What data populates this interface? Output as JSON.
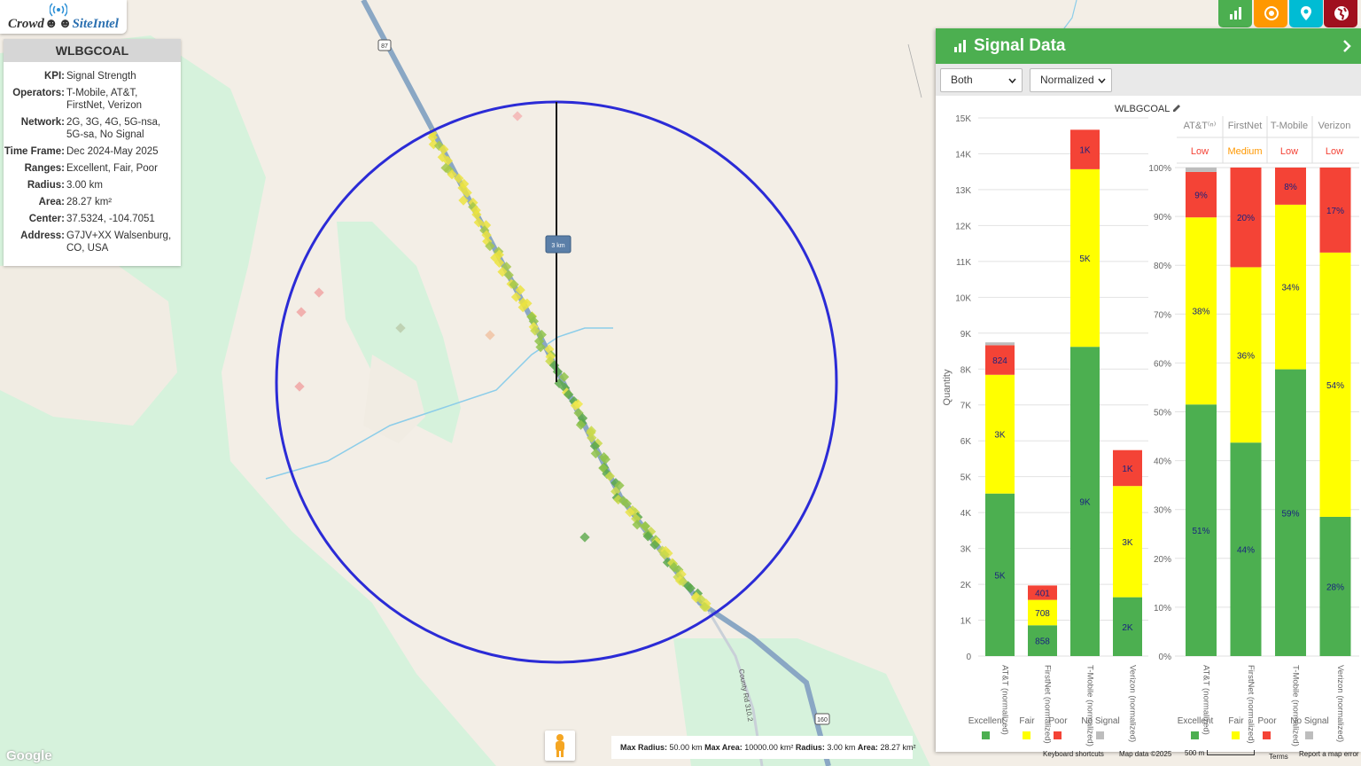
{
  "app": {
    "logo_crowd": "Crowd",
    "logo_site_intel": "SiteIntel"
  },
  "info_panel": {
    "title": "WLBGCOAL",
    "rows": [
      {
        "k": "KPI:",
        "v": "Signal Strength"
      },
      {
        "k": "Operators:",
        "v": "T-Mobile, AT&T, FirstNet, Verizon"
      },
      {
        "k": "Network:",
        "v": "2G, 3G, 4G, 5G-nsa, 5G-sa, No Signal"
      },
      {
        "k": "Time Frame:",
        "v": "Dec 2024-May 2025"
      },
      {
        "k": "Ranges:",
        "v": "Excellent, Fair, Poor"
      },
      {
        "k": "Radius:",
        "v": "3.00 km"
      },
      {
        "k": "Area:",
        "v": "28.27 km²"
      },
      {
        "k": "Center:",
        "v": "37.5324, -104.7051"
      },
      {
        "k": "Address:",
        "v": "G7JV+XX Walsenburg, CO, USA"
      }
    ]
  },
  "top_buttons": [
    {
      "name": "chart-button",
      "color": "#4caf50",
      "icon": "bar-chart-icon"
    },
    {
      "name": "target-button",
      "color": "#ff9800",
      "icon": "target-icon"
    },
    {
      "name": "location-button",
      "color": "#00bcd4",
      "icon": "map-pin-icon"
    },
    {
      "name": "globe-button",
      "color": "#a0101e",
      "icon": "globe-icon"
    }
  ],
  "map": {
    "radius_label": "3 km",
    "route_labels": {
      "r87": "87",
      "r160": "160",
      "county_rd": "County Rd 310.2"
    },
    "footer": {
      "max_radius_label": "Max Radius:",
      "max_radius": "50.00 km",
      "max_area_label": "Max Area:",
      "max_area": "10000.00 km²",
      "radius_label": "Radius:",
      "radius": "3.00 km",
      "area_label": "Area:",
      "area": "28.27 km²"
    },
    "google": "Google",
    "keyboard": "Keyboard shortcuts",
    "map_data": "Map data ©2025",
    "scale": "500 m",
    "terms": "Terms",
    "report": "Report a map error"
  },
  "signal_panel": {
    "title": "Signal Data",
    "select_mode": "Both",
    "select_norm": "Normalized",
    "site_label": "WLBGCOAL",
    "colors": {
      "Excellent": "#4caf50",
      "Fair": "#ffff00",
      "Poor": "#f44336",
      "No Signal": "#bdbdbd"
    },
    "col_headers": [
      "AT&T⁽ⁿ⁾",
      "FirstNet",
      "T-Mobile",
      "Verizon"
    ],
    "levels": [
      {
        "text": "Low",
        "color": "#f44336"
      },
      {
        "text": "Medium",
        "color": "#ff9800"
      },
      {
        "text": "Low",
        "color": "#f44336"
      },
      {
        "text": "Low",
        "color": "#f44336"
      }
    ]
  },
  "chart_data": [
    {
      "type": "bar",
      "stacked": true,
      "title": "WLBGCOAL",
      "ylabel": "Quantity",
      "ylim": [
        0,
        15000
      ],
      "yticks": [
        "0",
        "1K",
        "2K",
        "3K",
        "4K",
        "5K",
        "6K",
        "7K",
        "8K",
        "9K",
        "10K",
        "11K",
        "12K",
        "13K",
        "14K",
        "15K"
      ],
      "categories": [
        "AT&T (normalized)",
        "FirstNet (normalized)",
        "T-Mobile (normalized)",
        "Verizon (normalized)"
      ],
      "series": [
        {
          "name": "Excellent",
          "values": [
            4530,
            858,
            8620,
            1640
          ],
          "labels": [
            "5K",
            "858",
            "9K",
            "2K"
          ]
        },
        {
          "name": "Fair",
          "values": [
            3310,
            708,
            4950,
            3100
          ],
          "labels": [
            "3K",
            "708",
            "5K",
            "3K"
          ]
        },
        {
          "name": "Poor",
          "values": [
            824,
            401,
            1100,
            1000
          ],
          "labels": [
            "824",
            "401",
            "1K",
            "1K"
          ]
        },
        {
          "name": "No Signal",
          "values": [
            80,
            0,
            0,
            0
          ],
          "labels": [
            "",
            "",
            "",
            ""
          ]
        }
      ],
      "legend": [
        "Excellent",
        "Fair",
        "Poor",
        "No Signal"
      ]
    },
    {
      "type": "bar",
      "stacked": true,
      "percent": true,
      "ylim": [
        0,
        100
      ],
      "yticks": [
        "0%",
        "10%",
        "20%",
        "30%",
        "40%",
        "50%",
        "60%",
        "70%",
        "80%",
        "90%",
        "100%"
      ],
      "categories": [
        "AT&T (normalized)",
        "FirstNet (normalized)",
        "T-Mobile (normalized)",
        "Verizon (normalized)"
      ],
      "series": [
        {
          "name": "Excellent",
          "values": [
            51.5,
            43.7,
            58.7,
            28.5
          ],
          "labels": [
            "51%",
            "44%",
            "59%",
            "28%"
          ]
        },
        {
          "name": "Fair",
          "values": [
            38.3,
            35.9,
            33.7,
            54.1
          ],
          "labels": [
            "38%",
            "36%",
            "34%",
            "54%"
          ]
        },
        {
          "name": "Poor",
          "values": [
            9.3,
            20.4,
            7.6,
            17.4
          ],
          "labels": [
            "9%",
            "20%",
            "8%",
            "17%"
          ]
        },
        {
          "name": "No Signal",
          "values": [
            0.9,
            0,
            0,
            0
          ],
          "labels": [
            "",
            "",
            "",
            ""
          ]
        }
      ],
      "legend": [
        "Excellent",
        "Fair",
        "Poor",
        "No Signal"
      ]
    }
  ]
}
